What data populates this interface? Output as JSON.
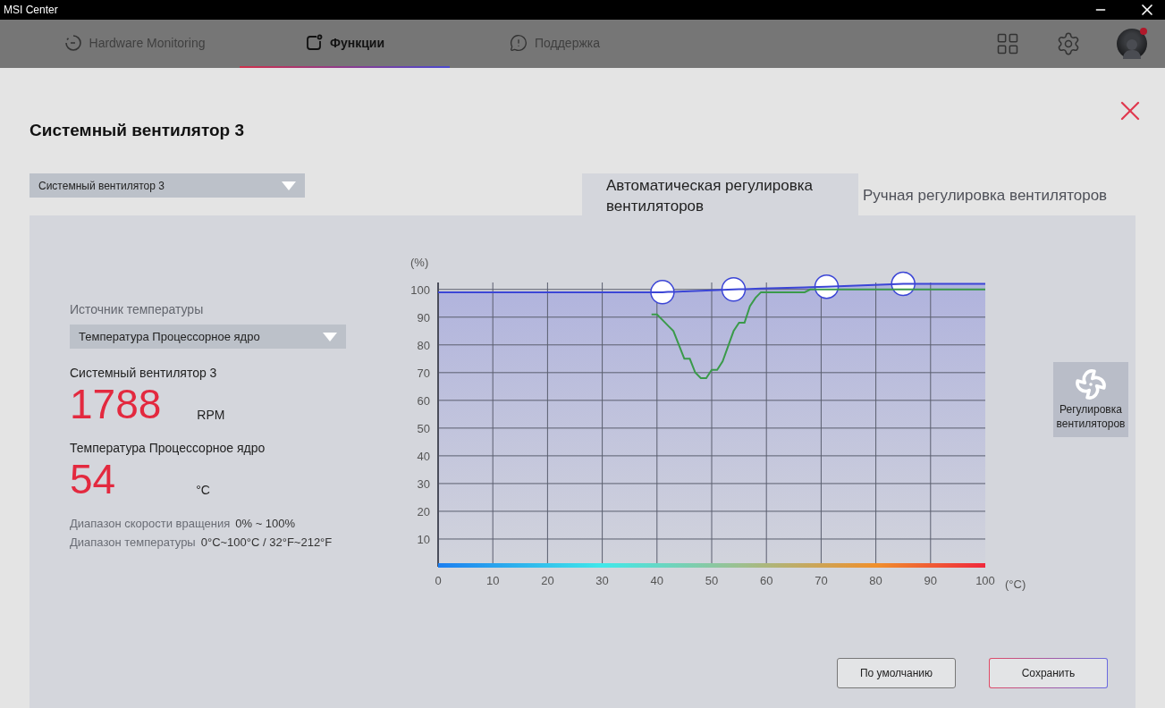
{
  "window": {
    "title": "MSI Center"
  },
  "nav": {
    "tabs": [
      {
        "label": "Hardware Monitoring",
        "selected": false
      },
      {
        "label": "Функции",
        "selected": true
      },
      {
        "label": "Поддержка",
        "selected": false
      }
    ],
    "notification": true
  },
  "page": {
    "title": "Системный вентилятор 3",
    "fan_select": {
      "value": "Системный вентилятор 3"
    },
    "mode_tabs": [
      {
        "label": "Автоматическая регулировка вентиляторов",
        "selected": true
      },
      {
        "label": "Ручная регулировка вентиляторов",
        "selected": false
      }
    ],
    "source": {
      "label": "Источник температуры",
      "value": "Температура Процессорное ядро"
    },
    "fan": {
      "label": "Системный вентилятор 3",
      "value": "1788",
      "unit": "RPM"
    },
    "temperature": {
      "label": "Температура Процессорное ядро",
      "value": "54",
      "unit": "°C"
    },
    "ranges": [
      {
        "label": "Диапазон скорости вращения",
        "value": "0% ~ 100%"
      },
      {
        "label": "Диапазон температуры",
        "value": "0°C~100°C / 32°F~212°F"
      }
    ],
    "chart_data": {
      "type": "line",
      "xlabel": "(°C)",
      "ylabel": "(%)",
      "x": [
        0,
        39,
        40,
        41,
        42,
        43,
        45,
        46,
        47,
        48,
        49,
        50,
        51,
        52,
        54,
        55,
        56,
        57,
        58,
        59,
        67,
        68,
        71,
        85,
        100
      ],
      "series": [
        {
          "color": "#3b45d6",
          "values": [
            99,
            99,
            99,
            99,
            99.077,
            99.154,
            99.308,
            99.385,
            99.462,
            99.538,
            99.615,
            99.692,
            99.769,
            99.846,
            100,
            100.059,
            100.118,
            100.176,
            100.235,
            100.294,
            100.765,
            100.824,
            101,
            102,
            102
          ]
        },
        {
          "color": "#3a9a4a",
          "values": [
            null,
            91,
            91,
            89,
            87,
            85,
            75,
            75,
            70,
            68,
            68,
            71,
            71,
            74,
            85,
            88,
            88,
            94,
            97,
            99,
            99,
            100,
            100,
            100,
            100
          ]
        }
      ],
      "xlim": [
        0,
        100
      ],
      "ylim": [
        0,
        102.5
      ],
      "xticks": [
        0,
        10,
        20,
        30,
        40,
        50,
        60,
        70,
        80,
        90,
        100
      ],
      "yticks": [
        10,
        20,
        30,
        40,
        50,
        60,
        70,
        80,
        90,
        100
      ],
      "grid": true
    },
    "fan_control_button": {
      "label": "Регулировка вентиляторов"
    },
    "buttons": [
      {
        "label": "По умолчанию",
        "kind": "default"
      },
      {
        "label": "Сохранить",
        "kind": "primary"
      }
    ]
  }
}
